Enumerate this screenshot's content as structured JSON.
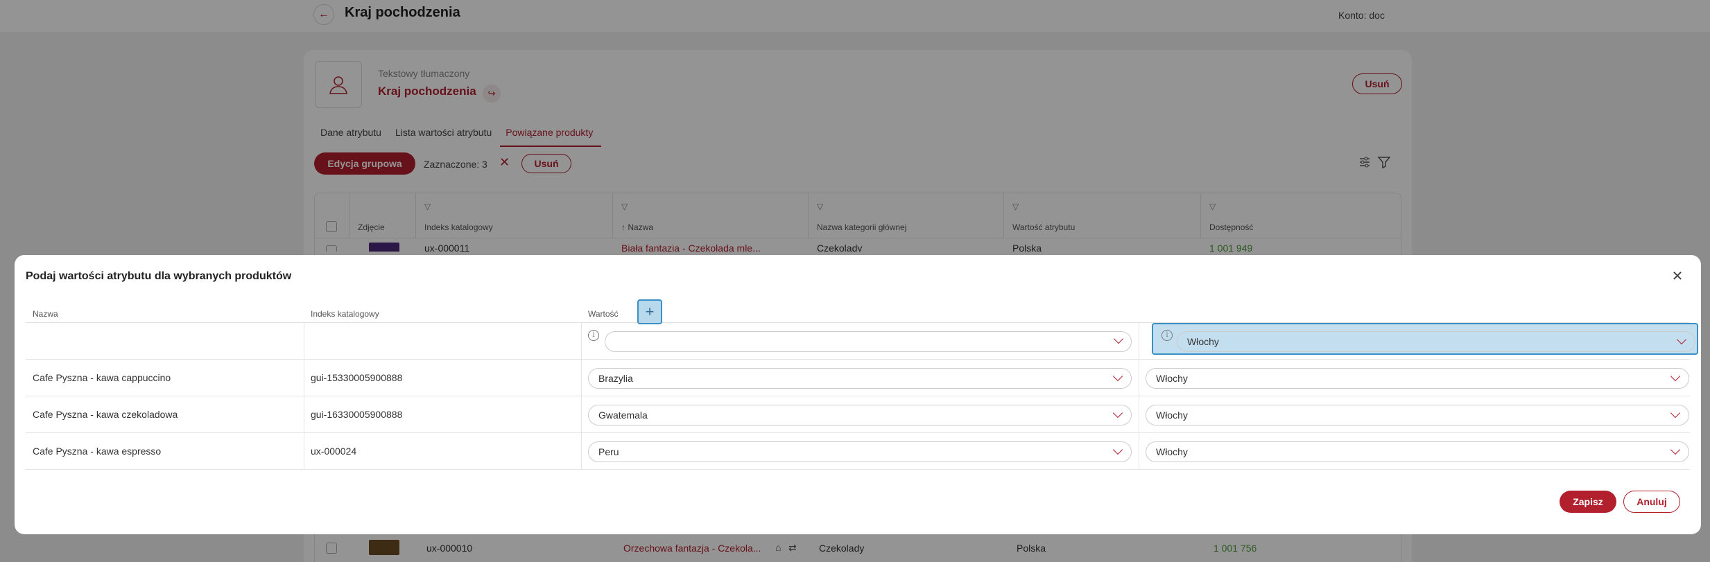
{
  "topbar": {
    "title": "Kraj pochodzenia",
    "account": "Konto: doc"
  },
  "header": {
    "subtitle": "Tekstowy tłumaczony",
    "title": "Kraj pochodzenia",
    "delete_label": "Usuń"
  },
  "tabs": [
    {
      "label": "Dane atrybutu"
    },
    {
      "label": "Lista wartości atrybutu"
    },
    {
      "label": "Powiązane produkty",
      "active": true
    }
  ],
  "toolbar": {
    "bulk_edit_label": "Edycja grupowa",
    "selected_label": "Zaznaczone: 3",
    "delete_label": "Usuń"
  },
  "bg_table": {
    "columns": [
      "Zdjęcie",
      "Indeks katalogowy",
      "↑ Nazwa",
      "Nazwa kategorii głównej",
      "Wartość atrybutu",
      "Dostępność"
    ],
    "first_row": {
      "index": "ux-000011",
      "name": "Biała fantazja - Czekolada mle...",
      "category": "Czekolady",
      "value": "Polska",
      "availability": "1 001 949"
    },
    "last_row": {
      "index": "ux-000010",
      "name": "Orzechowa fantazja - Czekola...",
      "category": "Czekolady",
      "value": "Polska",
      "availability": "1 001 756"
    }
  },
  "modal": {
    "title": "Podaj wartości atrybutu dla wybranych produktów",
    "headers": {
      "name": "Nazwa",
      "catalog_index": "Indeks katalogowy",
      "value": "Wartość"
    },
    "bulk_row": {
      "value_1": "",
      "value_2": "Włochy"
    },
    "rows": [
      {
        "name": "Cafe Pyszna - kawa cappuccino",
        "catalog_index": "gui-15330005900888",
        "value_1": "Brazylia",
        "value_2": "Włochy"
      },
      {
        "name": "Cafe Pyszna - kawa czekoladowa",
        "catalog_index": "gui-16330005900888",
        "value_1": "Gwatemala",
        "value_2": "Włochy"
      },
      {
        "name": "Cafe Pyszna - kawa espresso",
        "catalog_index": "ux-000024",
        "value_1": "Peru",
        "value_2": "Włochy"
      }
    ],
    "save_label": "Zapisz",
    "cancel_label": "Anuluj"
  },
  "colors": {
    "accent": "#b21f2d",
    "highlight": "#c3dfef",
    "availability": "#4f9a3a"
  }
}
